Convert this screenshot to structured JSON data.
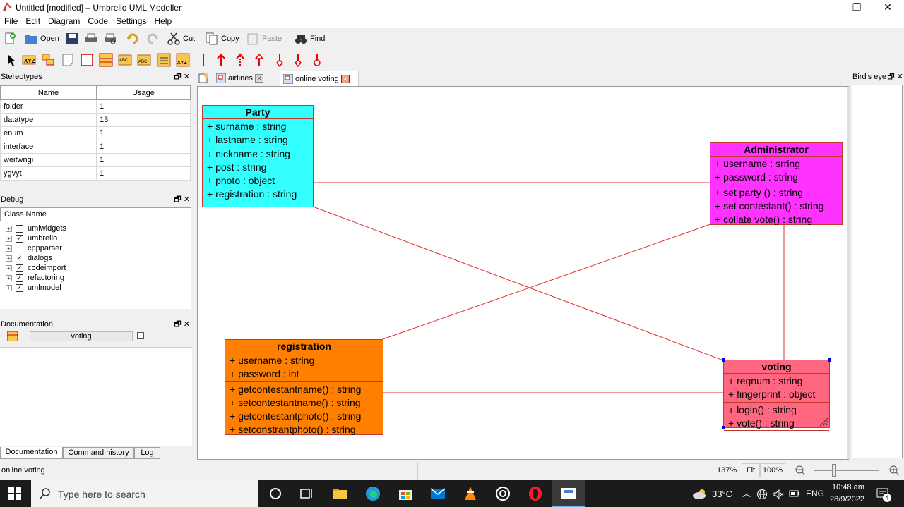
{
  "window": {
    "title": "Untitled [modified] – Umbrello UML Modeller"
  },
  "menu": [
    "File",
    "Edit",
    "Diagram",
    "Code",
    "Settings",
    "Help"
  ],
  "toolbar": {
    "open": "Open",
    "cut": "Cut",
    "copy": "Copy",
    "paste": "Paste",
    "find": "Find"
  },
  "stereotypes": {
    "title": "Stereotypes",
    "columns": [
      "Name",
      "Usage"
    ],
    "rows": [
      {
        "name": "folder",
        "usage": "1"
      },
      {
        "name": "datatype",
        "usage": "13"
      },
      {
        "name": "enum",
        "usage": "1"
      },
      {
        "name": "interface",
        "usage": "1"
      },
      {
        "name": "weifwngi",
        "usage": "1"
      },
      {
        "name": "ygvyt",
        "usage": "1"
      }
    ]
  },
  "debug": {
    "title": "Debug",
    "column": "Class Name",
    "items": [
      {
        "label": "umlwidgets",
        "checked": false
      },
      {
        "label": "umbrello",
        "checked": true
      },
      {
        "label": "cppparser",
        "checked": false
      },
      {
        "label": "dialogs",
        "checked": true
      },
      {
        "label": "codeimport",
        "checked": true
      },
      {
        "label": "refactoring",
        "checked": true
      },
      {
        "label": "umlmodel",
        "checked": true
      }
    ]
  },
  "documentation": {
    "title": "Documentation",
    "name": "voting"
  },
  "bottom_tabs": [
    "Documentation",
    "Command history",
    "Log"
  ],
  "tabs": [
    {
      "label": "airlines",
      "active": false
    },
    {
      "label": "online voting",
      "active": true
    }
  ],
  "birds_eye": {
    "title": "Bird's eye"
  },
  "diagram": {
    "classes": {
      "party": {
        "name": "Party",
        "attributes": [
          "+ surname : string",
          "+ lastname : string",
          "+ nickname : string",
          "+ post : string",
          "+ photo : object",
          "+ registration : string"
        ],
        "operations": [],
        "color": "#33ffff"
      },
      "administrator": {
        "name": "Administrator",
        "attributes": [
          "+ username : srring",
          "+ password : string"
        ],
        "operations": [
          "+ set party () : string",
          "+ set contestant() : string",
          "+ collate vote() : string"
        ],
        "color": "#ff33ff"
      },
      "registration": {
        "name": "registration",
        "attributes": [
          "+ username : string",
          "+ password : int"
        ],
        "operations": [
          "+ getcontestantname() : string",
          "+ setcontestantname() : string",
          "+ getcontestantphoto() : string",
          "+ setconstrantphoto() : string"
        ],
        "color": "#ff8000"
      },
      "voting": {
        "name": "voting",
        "attributes": [
          "+ regnum : string",
          "+ fingerprint : object"
        ],
        "operations": [
          "+ login() : string",
          "+ vote() : string"
        ],
        "color": "#ff6680"
      }
    },
    "line_color": "#e03030"
  },
  "status": {
    "text": "online voting",
    "zoom": "137%",
    "fit": "Fit",
    "hundred": "100%"
  },
  "taskbar": {
    "search_placeholder": "Type here to search",
    "temperature": "33°C",
    "language": "ENG",
    "time": "10:48 am",
    "date": "28/9/2022",
    "notifications": "4"
  }
}
